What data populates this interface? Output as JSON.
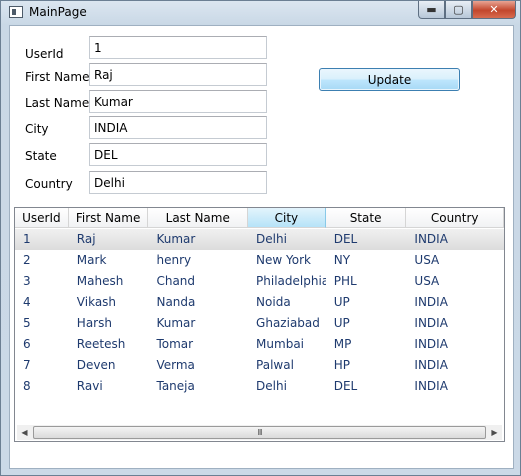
{
  "window": {
    "title": "MainPage",
    "minimize_glyph": "▬",
    "maximize_glyph": "▢",
    "close_glyph": "✕"
  },
  "form": {
    "fields": [
      {
        "label": "UserId",
        "value": "1"
      },
      {
        "label": "First Name",
        "value": "Raj"
      },
      {
        "label": "Last Name",
        "value": "Kumar"
      },
      {
        "label": "City",
        "value": "INDIA"
      },
      {
        "label": "State",
        "value": "DEL"
      },
      {
        "label": "Country",
        "value": "Delhi"
      }
    ],
    "update_label": "Update"
  },
  "grid": {
    "columns": [
      "UserId",
      "First Name",
      "Last Name",
      "City",
      "State",
      "Country"
    ],
    "hover_column": "City",
    "selected_row": "1",
    "rows": [
      [
        "1",
        "Raj",
        "Kumar",
        "Delhi",
        "DEL",
        "INDIA"
      ],
      [
        "2",
        "Mark",
        "henry",
        "New York",
        "NY",
        "USA"
      ],
      [
        "3",
        "Mahesh",
        "Chand",
        "Philadelphia",
        "PHL",
        "USA"
      ],
      [
        "4",
        "Vikash",
        "Nanda",
        "Noida",
        "UP",
        "INDIA"
      ],
      [
        "5",
        "Harsh",
        "Kumar",
        "Ghaziabad",
        "UP",
        "INDIA"
      ],
      [
        "6",
        "Reetesh",
        "Tomar",
        "Mumbai",
        "MP",
        "INDIA"
      ],
      [
        "7",
        "Deven",
        "Verma",
        "Palwal",
        "HP",
        "INDIA"
      ],
      [
        "8",
        "Ravi",
        "Taneja",
        "Delhi",
        "DEL",
        "INDIA"
      ]
    ],
    "scroll_thumb_grip": "III"
  },
  "colors": {
    "cell_text": "#1e3a6e",
    "hover_header": "#b6e3f8",
    "button_border": "#3c7fb1",
    "close_button": "#c2462c"
  }
}
